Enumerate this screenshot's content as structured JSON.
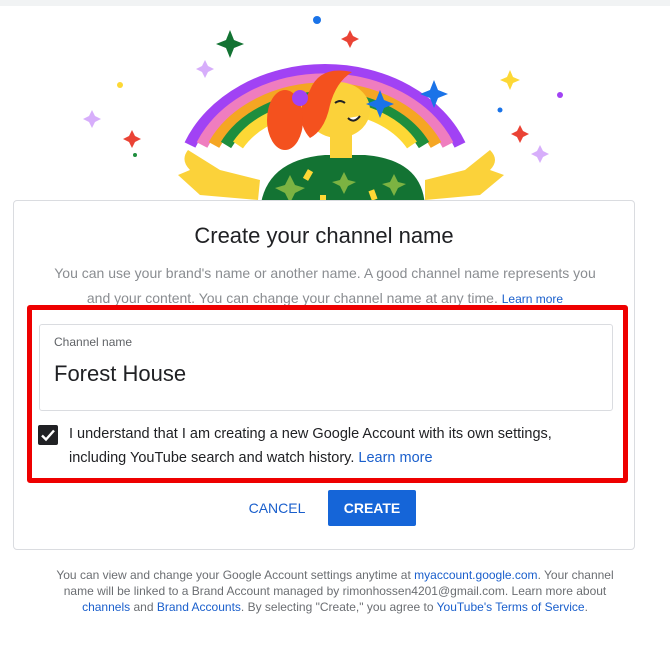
{
  "dialog": {
    "title": "Create your channel name",
    "description": "You can use your brand's name or another name. A good channel name represents you and your content. You can change your channel name at any time.",
    "learn_more": "Learn more"
  },
  "channel_field": {
    "label": "Channel name",
    "value": "Forest House"
  },
  "acknowledgement": {
    "checked": true,
    "text": "I understand that I am creating a new Google Account with its own settings, including YouTube search and watch history.",
    "learn_more": "Learn more"
  },
  "actions": {
    "cancel": "CANCEL",
    "create": "CREATE"
  },
  "footer": {
    "line1_pre": "You can view and change your Google Account settings anytime at",
    "myaccount_link": "myaccount.google.com",
    "line1_post": ". Your channel name will be linked to a Brand Account managed by rimonhossen4201@gmail.com.",
    "line2_pre": "Learn more about",
    "channels_link": "channels",
    "and": "and",
    "brand_accounts_link": "Brand Accounts",
    "line2_post": ". By selecting \"Create,\" you agree to",
    "tos_link": "YouTube's Terms of Service",
    "period": "."
  },
  "colors": {
    "accent": "#1565d8",
    "highlight": "#ee0000",
    "link": "#1a5fcc"
  }
}
